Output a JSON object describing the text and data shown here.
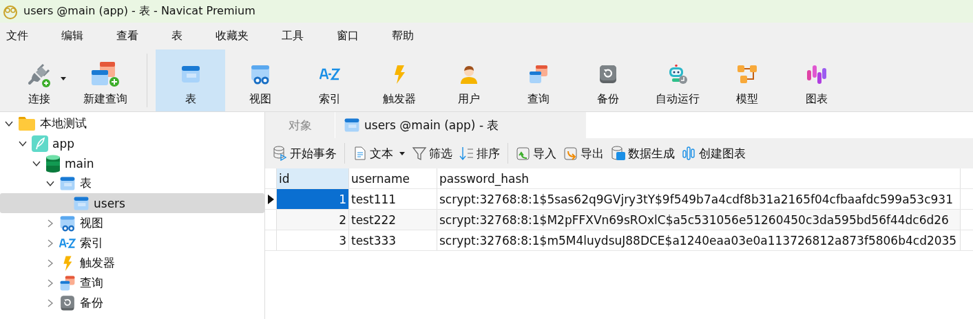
{
  "window": {
    "title": "users @main (app) - 表 - Navicat Premium"
  },
  "menu": [
    "文件",
    "编辑",
    "查看",
    "表",
    "收藏夹",
    "工具",
    "窗口",
    "帮助"
  ],
  "toolbar": [
    {
      "label": "连接",
      "selected": false,
      "dropdown": true
    },
    {
      "label": "新建查询",
      "selected": false,
      "dropdown": false
    },
    {
      "label": "表",
      "selected": true,
      "dropdown": false
    },
    {
      "label": "视图",
      "selected": false,
      "dropdown": false
    },
    {
      "label": "索引",
      "selected": false,
      "dropdown": false
    },
    {
      "label": "触发器",
      "selected": false,
      "dropdown": false
    },
    {
      "label": "用户",
      "selected": false,
      "dropdown": false
    },
    {
      "label": "查询",
      "selected": false,
      "dropdown": false
    },
    {
      "label": "备份",
      "selected": false,
      "dropdown": false
    },
    {
      "label": "自动运行",
      "selected": false,
      "dropdown": false
    },
    {
      "label": "模型",
      "selected": false,
      "dropdown": false
    },
    {
      "label": "图表",
      "selected": false,
      "dropdown": false
    }
  ],
  "tree": [
    {
      "label": "本地测试",
      "kind": "folder",
      "expanded": true,
      "selected": false,
      "children": [
        {
          "label": "app",
          "kind": "connection",
          "expanded": true,
          "selected": false,
          "children": [
            {
              "label": "main",
              "kind": "database",
              "expanded": true,
              "selected": false,
              "children": [
                {
                  "label": "表",
                  "kind": "tables",
                  "expanded": true,
                  "selected": false,
                  "children": [
                    {
                      "label": "users",
                      "kind": "table",
                      "selected": true
                    }
                  ]
                },
                {
                  "label": "视图",
                  "kind": "views",
                  "expanded": false,
                  "selected": false
                },
                {
                  "label": "索引",
                  "kind": "indexes",
                  "expanded": false,
                  "selected": false
                },
                {
                  "label": "触发器",
                  "kind": "triggers",
                  "expanded": false,
                  "selected": false
                },
                {
                  "label": "查询",
                  "kind": "queries",
                  "expanded": false,
                  "selected": false
                },
                {
                  "label": "备份",
                  "kind": "backups",
                  "expanded": false,
                  "selected": false
                }
              ]
            }
          ]
        }
      ]
    }
  ],
  "tabs": [
    {
      "label": "对象",
      "selected": false
    },
    {
      "label": "users @main (app) - 表",
      "selected": true
    }
  ],
  "actions": [
    {
      "label": "开始事务",
      "dropdown": false
    },
    {
      "label": "文本",
      "dropdown": true
    },
    {
      "label": "筛选",
      "dropdown": false
    },
    {
      "label": "排序",
      "dropdown": false
    },
    {
      "label": "导入",
      "dropdown": false
    },
    {
      "label": "导出",
      "dropdown": false
    },
    {
      "label": "数据生成",
      "dropdown": false
    },
    {
      "label": "创建图表",
      "dropdown": false
    }
  ],
  "table": {
    "columns": [
      "id",
      "username",
      "password_hash"
    ],
    "rows": [
      {
        "selected": true,
        "cells": [
          "1",
          "test111",
          "scrypt:32768:8:1$5sas62q9GVjry3tY$9f549b7a4cdf8b31a2165f04cfbaafdc599a53c931"
        ]
      },
      {
        "selected": false,
        "cells": [
          "2",
          "test222",
          "scrypt:32768:8:1$M2pFFXVn69sROxlC$a5c531056e51260450c3da595bd56f44dc6d26"
        ]
      },
      {
        "selected": false,
        "cells": [
          "3",
          "test333",
          "scrypt:32768:8:1$m5M4luydsuJ88DCE$a1240eaa03e0a113726812a873f5806b4cd2035"
        ]
      }
    ]
  }
}
